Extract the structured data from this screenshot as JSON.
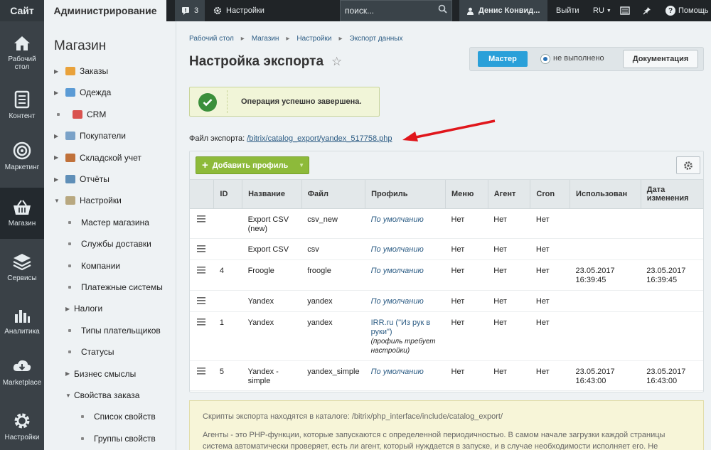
{
  "topbar": {
    "site_tab": "Сайт",
    "admin_tab": "Администрирование",
    "notifications_count": "3",
    "settings_label": "Настройки",
    "search_placeholder": "поиск...",
    "user_name": "Денис Конвид...",
    "logout": "Выйти",
    "lang": "RU",
    "help": "Помощь"
  },
  "leftnav": [
    {
      "label": "Рабочий стол",
      "icon": "home-icon"
    },
    {
      "label": "Контент",
      "icon": "document-icon"
    },
    {
      "label": "Маркетинг",
      "icon": "target-icon"
    },
    {
      "label": "Магазин",
      "icon": "basket-icon"
    },
    {
      "label": "Сервисы",
      "icon": "layers-icon"
    },
    {
      "label": "Аналитика",
      "icon": "chart-icon"
    },
    {
      "label": "Marketplace",
      "icon": "cloud-download-icon"
    },
    {
      "label": "Настройки",
      "icon": "gear-icon"
    }
  ],
  "menu": {
    "title": "Магазин",
    "items": [
      {
        "label": "Заказы",
        "type": "folder"
      },
      {
        "label": "Одежда",
        "type": "folder"
      },
      {
        "label": "CRM",
        "type": "leaf"
      },
      {
        "label": "Покупатели",
        "type": "folder"
      },
      {
        "label": "Складской учет",
        "type": "folder"
      },
      {
        "label": "Отчёты",
        "type": "folder"
      },
      {
        "label": "Настройки",
        "type": "open"
      },
      {
        "label": "Мастер магазина",
        "type": "sub"
      },
      {
        "label": "Службы доставки",
        "type": "sub"
      },
      {
        "label": "Компании",
        "type": "sub"
      },
      {
        "label": "Платежные системы",
        "type": "sub"
      },
      {
        "label": "Налоги",
        "type": "subfolder"
      },
      {
        "label": "Типы плательщиков",
        "type": "sub"
      },
      {
        "label": "Статусы",
        "type": "sub"
      },
      {
        "label": "Бизнес смыслы",
        "type": "subfolder"
      },
      {
        "label": "Свойства заказа",
        "type": "subopen"
      },
      {
        "label": "Список свойств",
        "type": "subsub"
      },
      {
        "label": "Группы свойств",
        "type": "subsub"
      }
    ]
  },
  "breadcrumb": [
    "Рабочий стол",
    "Магазин",
    "Настройки",
    "Экспорт данных"
  ],
  "page_title": "Настройка экспорта",
  "wizard": {
    "button": "Мастер",
    "status": "не выполнено",
    "docs": "Документация"
  },
  "success_message": "Операция успешно завершена.",
  "export_file": {
    "label": "Файл экспорта:",
    "link": "/bitrix/catalog_export/yandex_517758.php"
  },
  "toolbar": {
    "add_profile": "Добавить профиль"
  },
  "table": {
    "headers": [
      "",
      "ID",
      "Название",
      "Файл",
      "Профиль",
      "Меню",
      "Агент",
      "Cron",
      "Использован",
      "Дата изменения"
    ],
    "rows": [
      {
        "id": "",
        "name": "Export CSV (new)",
        "file": "csv_new",
        "profile": "По умолчанию",
        "profile_note": "",
        "menu": "Нет",
        "agent": "Нет",
        "cron": "Нет",
        "used": "",
        "changed": ""
      },
      {
        "id": "",
        "name": "Export CSV",
        "file": "csv",
        "profile": "По умолчанию",
        "profile_note": "",
        "menu": "Нет",
        "agent": "Нет",
        "cron": "Нет",
        "used": "",
        "changed": ""
      },
      {
        "id": "4",
        "name": "Froogle",
        "file": "froogle",
        "profile": "По умолчанию",
        "profile_note": "",
        "menu": "Нет",
        "agent": "Нет",
        "cron": "Нет",
        "used": "23.05.2017 16:39:45",
        "changed": "23.05.2017 16:39:45"
      },
      {
        "id": "",
        "name": "Yandex",
        "file": "yandex",
        "profile": "По умолчанию",
        "profile_note": "",
        "menu": "Нет",
        "agent": "Нет",
        "cron": "Нет",
        "used": "",
        "changed": ""
      },
      {
        "id": "1",
        "name": "Yandex",
        "file": "yandex",
        "profile": "IRR.ru (\"Из рук в руки\")",
        "profile_note": "(профиль требует настройки)",
        "menu": "Нет",
        "agent": "Нет",
        "cron": "Нет",
        "used": "",
        "changed": ""
      },
      {
        "id": "5",
        "name": "Yandex - simple",
        "file": "yandex_simple",
        "profile": "По умолчанию",
        "profile_note": "",
        "menu": "Нет",
        "agent": "Нет",
        "cron": "Нет",
        "used": "23.05.2017 16:43:00",
        "changed": "23.05.2017 16:43:00"
      }
    ]
  },
  "note": {
    "p1": "Скрипты экспорта находятся в каталоге: /bitrix/php_interface/include/catalog_export/",
    "p2": "Агенты - это PHP-функции, которые запускаются с определенной периодичностью. В самом начале загрузки каждой страницы система автоматически проверяет, есть ли агент, который нуждается в запуске, и в случае необходимости исполняет его. Не"
  }
}
